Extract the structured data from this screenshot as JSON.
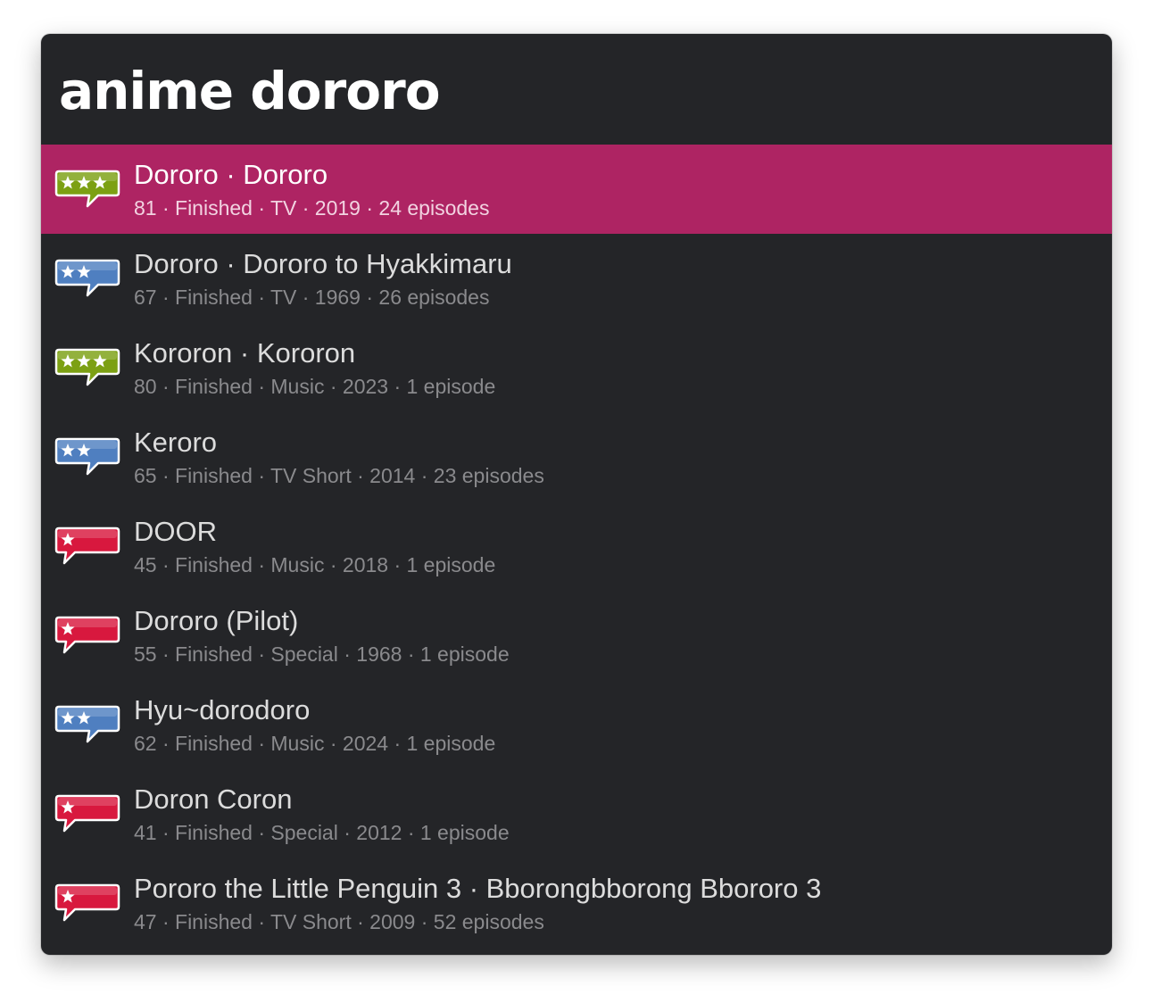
{
  "search": {
    "query": "anime dororo"
  },
  "colors": {
    "window_bg": "#242528",
    "selected_row": "#ae2463",
    "rating_green": "#7ca013",
    "rating_blue": "#4f7fc0",
    "rating_red": "#d8183e"
  },
  "results": [
    {
      "title": "Dororo · Dororo",
      "subtitle": "81 · Finished · TV · 2019 · 24 episodes",
      "icon": "three-star-green-speech-bubble-icon",
      "stars": 3,
      "selected": true
    },
    {
      "title": "Dororo · Dororo to Hyakkimaru",
      "subtitle": "67 · Finished · TV · 1969 · 26 episodes",
      "icon": "two-star-blue-speech-bubble-icon",
      "stars": 2,
      "selected": false
    },
    {
      "title": "Kororon · Kororon",
      "subtitle": "80 · Finished · Music · 2023 · 1 episode",
      "icon": "three-star-green-speech-bubble-icon",
      "stars": 3,
      "selected": false
    },
    {
      "title": "Keroro",
      "subtitle": "65 · Finished · TV Short · 2014 · 23 episodes",
      "icon": "two-star-blue-speech-bubble-icon",
      "stars": 2,
      "selected": false
    },
    {
      "title": "DOOR",
      "subtitle": "45 · Finished · Music · 2018 · 1 episode",
      "icon": "one-star-red-speech-bubble-icon",
      "stars": 1,
      "selected": false
    },
    {
      "title": "Dororo (Pilot)",
      "subtitle": "55 · Finished · Special · 1968 · 1 episode",
      "icon": "one-star-red-speech-bubble-icon",
      "stars": 1,
      "selected": false
    },
    {
      "title": "Hyu~dorodoro",
      "subtitle": "62 · Finished · Music · 2024 · 1 episode",
      "icon": "two-star-blue-speech-bubble-icon",
      "stars": 2,
      "selected": false
    },
    {
      "title": "Doron Coron",
      "subtitle": "41 · Finished · Special · 2012 · 1 episode",
      "icon": "one-star-red-speech-bubble-icon",
      "stars": 1,
      "selected": false
    },
    {
      "title": "Pororo the Little Penguin 3 · Bborongbborong Bbororo 3",
      "subtitle": "47 · Finished · TV Short · 2009 · 52 episodes",
      "icon": "one-star-red-speech-bubble-icon",
      "stars": 1,
      "selected": false
    }
  ]
}
